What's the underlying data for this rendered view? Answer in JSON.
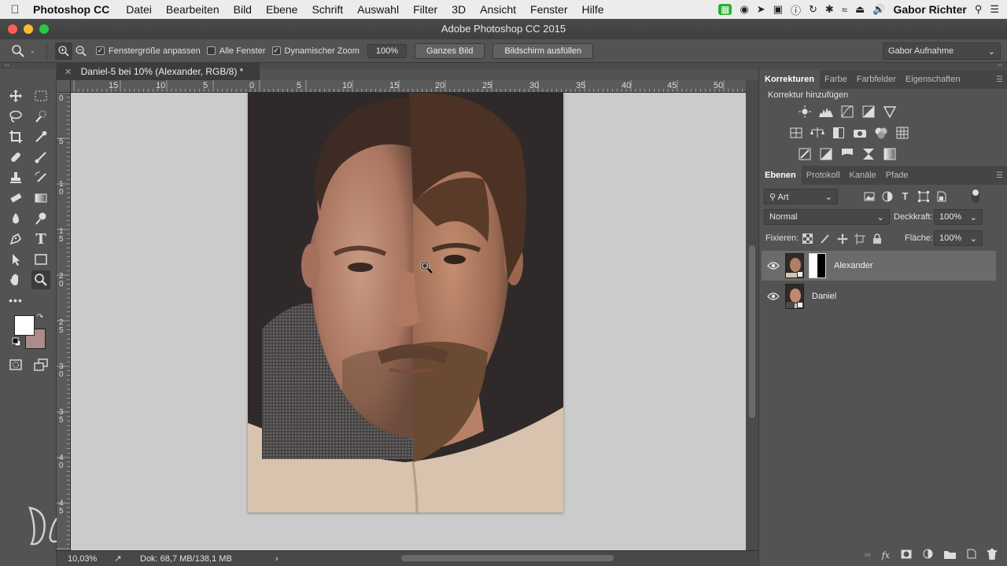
{
  "menubar": {
    "app_name": "Photoshop CC",
    "items": [
      "Datei",
      "Bearbeiten",
      "Bild",
      "Ebene",
      "Schrift",
      "Auswahl",
      "Filter",
      "3D",
      "Ansicht",
      "Fenster",
      "Hilfe"
    ],
    "user": "Gabor Richter"
  },
  "window": {
    "title": "Adobe Photoshop CC 2015"
  },
  "options": {
    "resize_windows": "Fenstergröße anpassen",
    "resize_windows_checked": true,
    "all_windows": "Alle Fenster",
    "all_windows_checked": false,
    "scrubby_zoom": "Dynamischer Zoom",
    "scrubby_zoom_checked": true,
    "zoom_value": "100%",
    "fit_screen": "Ganzes Bild",
    "fill_screen": "Bildschirm ausfüllen",
    "workspace": "Gabor Aufnahme"
  },
  "document": {
    "tab_title": "Daniel-5 bei 10% (Alexander, RGB/8) *"
  },
  "rulers": {
    "horizontal_labels": [
      "15",
      "10",
      "5",
      "0",
      "5",
      "10",
      "15",
      "20",
      "25",
      "30",
      "35",
      "40",
      "45",
      "50"
    ],
    "vertical_labels": [
      "0",
      "5",
      "1 0",
      "1 5",
      "2 0",
      "2 5",
      "3 0",
      "3 5",
      "4 0",
      "4 5"
    ]
  },
  "status": {
    "zoom": "10,03%",
    "doc_size": "Dok: 68,7 MB/138,1 MB"
  },
  "adjustments_panel": {
    "tabs": [
      "Korrekturen",
      "Farbe",
      "Farbfelder",
      "Eigenschaften"
    ],
    "active_tab": "Korrekturen",
    "heading": "Korrektur hinzufügen"
  },
  "layers_panel": {
    "tabs": [
      "Ebenen",
      "Protokoll",
      "Kanäle",
      "Pfade"
    ],
    "active_tab": "Ebenen",
    "filter_label": "Art",
    "blend_mode": "Normal",
    "opacity_label": "Deckkraft:",
    "opacity_value": "100%",
    "lock_label": "Fixieren:",
    "fill_label": "Fläche:",
    "fill_value": "100%",
    "layers": [
      {
        "name": "Alexander",
        "selected": true,
        "visible": true,
        "has_mask": true
      },
      {
        "name": "Daniel",
        "selected": false,
        "visible": true,
        "has_mask": false
      }
    ]
  },
  "colors": {
    "foreground": "#ffffff",
    "background": "#ad8b8b",
    "ui_panel": "#535353",
    "canvas_bg": "#cbcbcb"
  }
}
